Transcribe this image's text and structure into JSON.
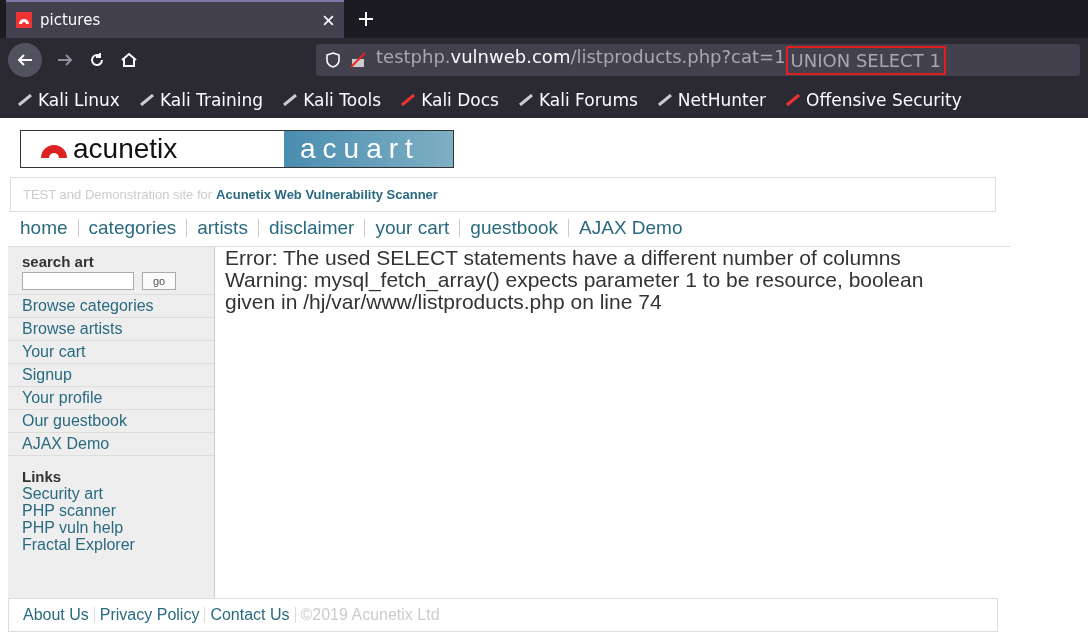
{
  "browser": {
    "tab": {
      "title": "pictures",
      "selected": true
    },
    "url": {
      "prefix": "testphp.",
      "domain": "vulnweb.com",
      "path": "/listproducts.php?cat=1",
      "injected": "UNION SELECT 1"
    },
    "bookmarks": [
      "Kali Linux",
      "Kali Training",
      "Kali Tools",
      "Kali Docs",
      "Kali Forums",
      "NetHunter",
      "Offensive Security"
    ]
  },
  "logo": {
    "brand": "acunetix",
    "site": "acuart"
  },
  "tagline": {
    "text": "TEST and Demonstration site for",
    "link": "Acunetix Web Vulnerability Scanner"
  },
  "nav": [
    "home",
    "categories",
    "artists",
    "disclaimer",
    "your cart",
    "guestbook",
    "AJAX Demo"
  ],
  "sidebar": {
    "search_title": "search art",
    "go": "go",
    "items": [
      "Browse categories",
      "Browse artists",
      "Your cart",
      "Signup",
      "Your profile",
      "Our guestbook",
      "AJAX Demo"
    ],
    "links_title": "Links",
    "links": [
      "Security art",
      "PHP scanner",
      "PHP vuln help",
      "Fractal Explorer"
    ]
  },
  "messages": [
    "Error: The used SELECT statements have a different number of columns",
    "Warning: mysql_fetch_array() expects parameter 1 to be resource, boolean given in /hj/var/www/listproducts.php on line 74"
  ],
  "footer": {
    "links": [
      "About Us",
      "Privacy Policy",
      "Contact Us"
    ],
    "copyright": "©2019 Acunetix Ltd"
  }
}
